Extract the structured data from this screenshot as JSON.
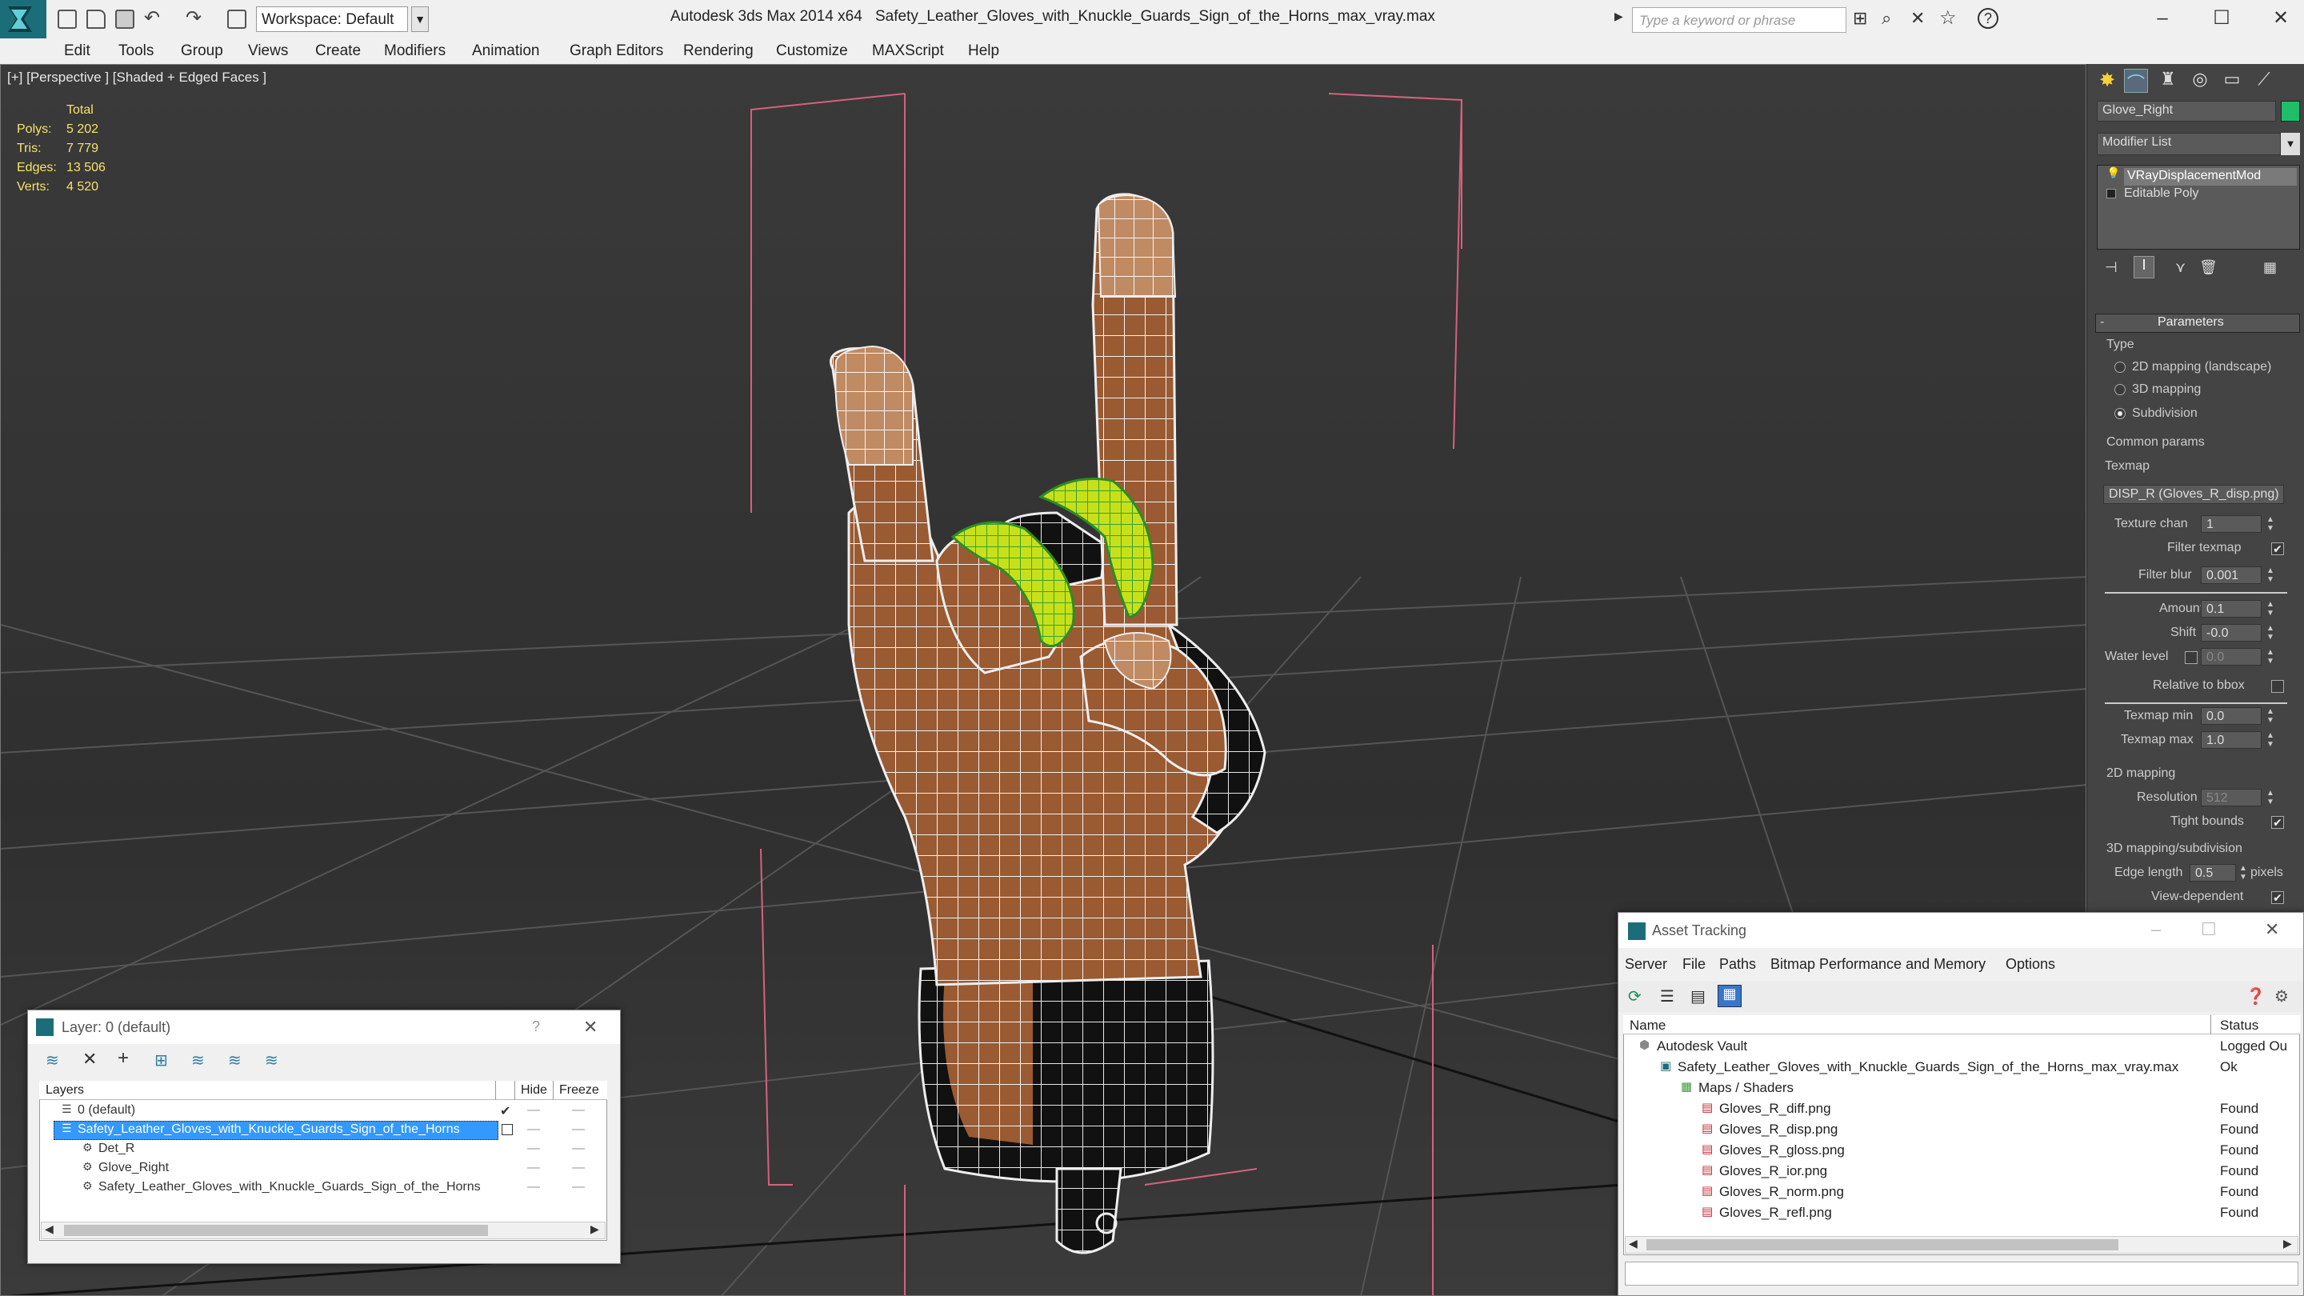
{
  "app": {
    "title": "Autodesk 3ds Max  2014 x64",
    "filename": "Safety_Leather_Gloves_with_Knuckle_Guards_Sign_of_the_Horns_max_vray.max",
    "workspace": "Workspace: Default",
    "search_placeholder": "Type a keyword or phrase"
  },
  "menu": [
    "Edit",
    "Tools",
    "Group",
    "Views",
    "Create",
    "Modifiers",
    "Animation",
    "Graph Editors",
    "Rendering",
    "Customize",
    "MAXScript",
    "Help"
  ],
  "viewport": {
    "label": "[+] [Perspective ] [Shaded + Edged Faces ]",
    "stats": {
      "header": "Total",
      "rows": [
        {
          "label": "Polys:",
          "value": "5 202"
        },
        {
          "label": "Tris:",
          "value": "7 779"
        },
        {
          "label": "Edges:",
          "value": "13 506"
        },
        {
          "label": "Verts:",
          "value": "4 520"
        }
      ]
    }
  },
  "command_panel": {
    "object_name": "Glove_Right",
    "object_color": "#1fbf6a",
    "modifier_list": "Modifier List",
    "stack": [
      "VRayDisplacementMod",
      "Editable Poly"
    ],
    "rollout_title": "Parameters",
    "type_group": "Type",
    "type_options": [
      "2D mapping (landscape)",
      "3D mapping",
      "Subdivision"
    ],
    "type_selected": 2,
    "common_params": "Common params",
    "texmap_label": "Texmap",
    "texmap_value": "DISP_R (Gloves_R_disp.png)",
    "texture_chan_label": "Texture chan",
    "texture_chan_value": "1",
    "filter_texmap_label": "Filter texmap",
    "filter_blur_label": "Filter blur",
    "filter_blur_value": "0.001",
    "amount_label": "Amount",
    "amount_value": "0.1",
    "shift_label": "Shift",
    "shift_value": "-0.0",
    "water_level_label": "Water level",
    "water_level_value": "0.0",
    "relative_bbox_label": "Relative to bbox",
    "texmap_min_label": "Texmap min",
    "texmap_min_value": "0.0",
    "texmap_max_label": "Texmap max",
    "texmap_max_value": "1.0",
    "mapping2d_group": "2D mapping",
    "resolution_label": "Resolution",
    "resolution_value": "512",
    "tight_bounds_label": "Tight bounds",
    "mapping3d_group": "3D mapping/subdivision",
    "edge_length_label": "Edge length",
    "edge_length_value": "0.5",
    "pixels_label": "pixels",
    "view_dependent_label": "View-dependent"
  },
  "layer_dialog": {
    "title": "Layer: 0 (default)",
    "help": "?",
    "columns": [
      "Layers",
      "Hide",
      "Freeze"
    ],
    "rows": [
      {
        "name": "0 (default)",
        "indent": 0,
        "selected": false,
        "check": "✔"
      },
      {
        "name": "Safety_Leather_Gloves_with_Knuckle_Guards_Sign_of_the_Horns",
        "indent": 0,
        "selected": true,
        "check": ""
      },
      {
        "name": "Det_R",
        "indent": 1,
        "selected": false,
        "check": ""
      },
      {
        "name": "Glove_Right",
        "indent": 1,
        "selected": false,
        "check": ""
      },
      {
        "name": "Safety_Leather_Gloves_with_Knuckle_Guards_Sign_of_the_Horns",
        "indent": 1,
        "selected": false,
        "check": ""
      }
    ]
  },
  "asset_dialog": {
    "title": "Asset Tracking",
    "menu": [
      "Server",
      "File",
      "Paths",
      "Bitmap Performance and Memory",
      "Options"
    ],
    "columns": [
      "Name",
      "Status"
    ],
    "rows": [
      {
        "name": "Autodesk Vault",
        "status": "Logged Ou",
        "indent": 0,
        "icon": "vault"
      },
      {
        "name": "Safety_Leather_Gloves_with_Knuckle_Guards_Sign_of_the_Horns_max_vray.max",
        "status": "Ok",
        "indent": 1,
        "icon": "max"
      },
      {
        "name": "Maps / Shaders",
        "status": "",
        "indent": 2,
        "icon": "maps"
      },
      {
        "name": "Gloves_R_diff.png",
        "status": "Found",
        "indent": 3,
        "icon": "png"
      },
      {
        "name": "Gloves_R_disp.png",
        "status": "Found",
        "indent": 3,
        "icon": "png"
      },
      {
        "name": "Gloves_R_gloss.png",
        "status": "Found",
        "indent": 3,
        "icon": "png"
      },
      {
        "name": "Gloves_R_ior.png",
        "status": "Found",
        "indent": 3,
        "icon": "png"
      },
      {
        "name": "Gloves_R_norm.png",
        "status": "Found",
        "indent": 3,
        "icon": "png"
      },
      {
        "name": "Gloves_R_refl.png",
        "status": "Found",
        "indent": 3,
        "icon": "png"
      }
    ]
  }
}
